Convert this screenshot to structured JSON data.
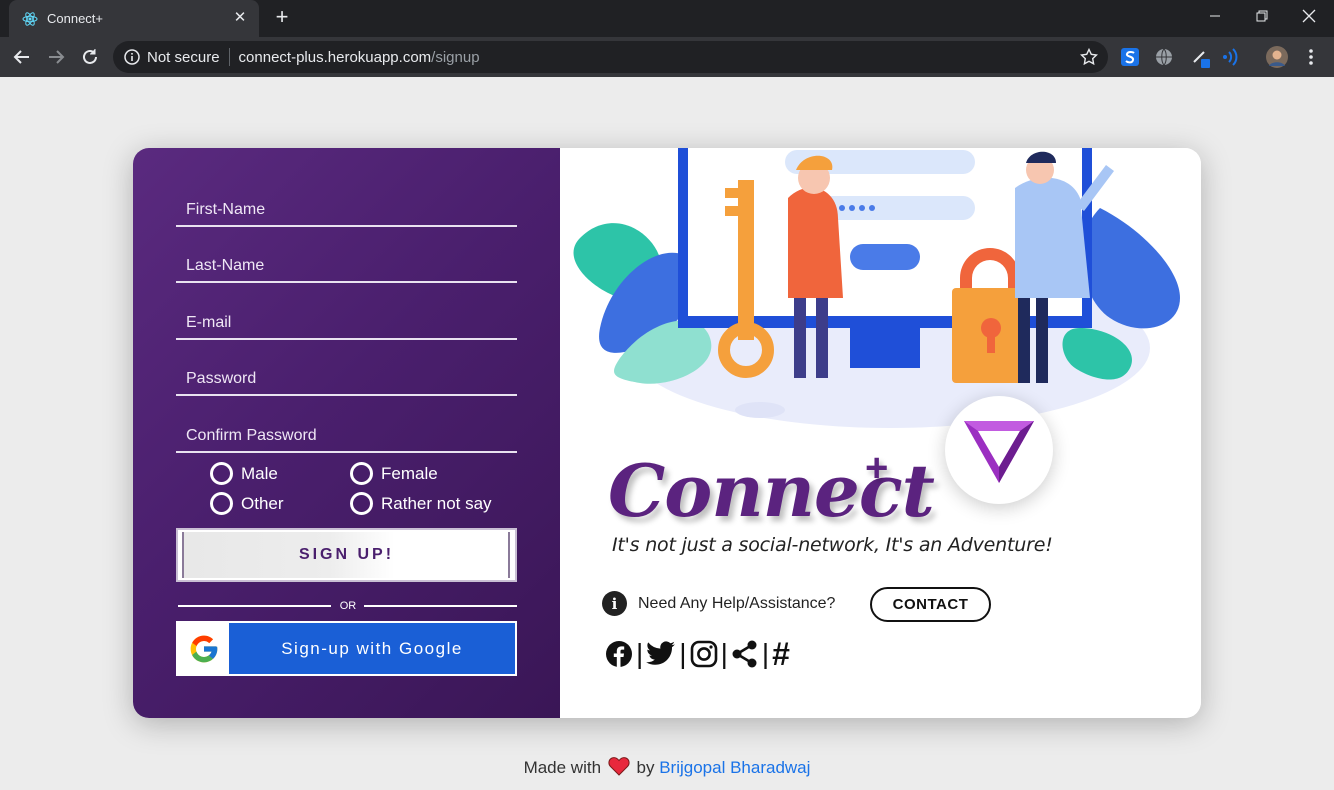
{
  "browser": {
    "tab_title": "Connect+",
    "tab_close": "✕",
    "new_tab": "+",
    "security_label": "Not secure",
    "url_host": "connect-plus.herokuapp.com",
    "url_path": "/signup"
  },
  "signup_form": {
    "first_name_placeholder": "First-Name",
    "last_name_placeholder": "Last-Name",
    "email_placeholder": "E-mail",
    "password_placeholder": "Password",
    "confirm_password_placeholder": "Confirm Password",
    "gender_options": [
      "Male",
      "Female",
      "Other",
      "Rather not say"
    ],
    "signup_button": "SIGN UP!",
    "or_label": "OR",
    "google_button": "Sign-up with Google"
  },
  "brand": {
    "name": "Connect",
    "plus": "+",
    "tagline": "It's not just a social-network, It's an Adventure!"
  },
  "help": {
    "info_icon": "i",
    "text": "Need Any Help/Assistance?",
    "contact_button": "CONTACT"
  },
  "social": {
    "icons": [
      "facebook-icon",
      "twitter-icon",
      "instagram-icon",
      "share-icon",
      "hashtag-icon"
    ],
    "separator": "|",
    "hashtag": "#"
  },
  "footer": {
    "prefix": "Made with",
    "by": "by",
    "author": "Brijgopal Bharadwaj"
  },
  "colors": {
    "brand_purple": "#5b237f",
    "google_blue": "#1a5fd6",
    "link_blue": "#1a73e8"
  }
}
